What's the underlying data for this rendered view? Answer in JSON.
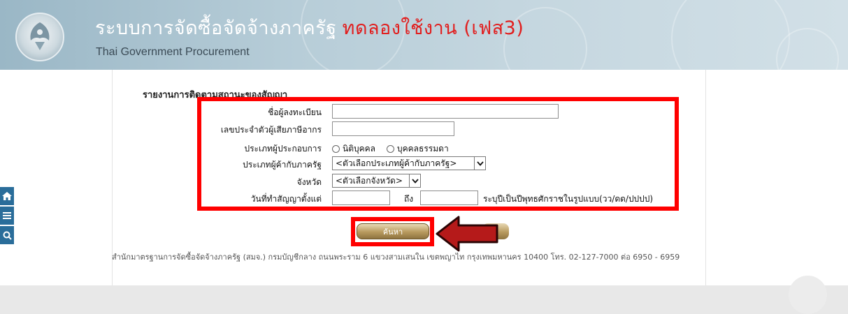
{
  "header": {
    "title_th": "ระบบการจัดซื้อจัดจ้างภาครัฐ",
    "title_beta": "ทดลองใช้งาน (เฟส3)",
    "title_en": "Thai Government Procurement",
    "logo_icon": "government-seal-icon"
  },
  "sidebar": {
    "tools": [
      {
        "icon": "home-icon",
        "glyph": "⌂"
      },
      {
        "icon": "menu-icon",
        "glyph": "≡"
      },
      {
        "icon": "search-icon",
        "glyph": "⚲"
      }
    ]
  },
  "page": {
    "title": "รายงานการติดตามสถานะของสัญญา"
  },
  "form": {
    "registrant_label": "ชื่อผู้ลงทะเบียน",
    "registrant_value": "",
    "tax_id_label": "เลขประจำตัวผู้เสียภาษีอากร",
    "tax_id_value": "",
    "operator_type_label": "ประเภทผู้ประกอบการ",
    "operator_type_options": [
      "นิติบุคคล",
      "บุคคลธรรมดา"
    ],
    "vendor_type_label": "ประเภทผู้ค้ากับภาครัฐ",
    "vendor_type_selected": "<ตัวเลือกประเภทผู้ค้ากับภาครัฐ>",
    "province_label": "จังหวัด",
    "province_selected": "<ตัวเลือกจังหวัด>",
    "date_label": "วันที่ทำสัญญาตั้งแต่",
    "date_from": "",
    "date_to_label": "ถึง",
    "date_to": "",
    "date_hint": "ระบุปีเป็นปีพุทธศักราชในรูปแบบ(วว/ดด/ปปปป)"
  },
  "actions": {
    "search_label": "ค้นหา"
  },
  "footer": {
    "text": "สำนักมาตรฐานการจัดซื้อจัดจ้างภาครัฐ (สมจ.) กรมบัญชีกลาง ถนนพระราม 6 แขวงสามเสนใน เขตพญาไท กรุงเทพมหานคร 10400 โทร. 02-127-7000 ต่อ 6950 - 6959"
  },
  "colors": {
    "highlight": "#ff0000",
    "beta_text": "#e11f1f",
    "sidebar": "#2a6d9a"
  }
}
